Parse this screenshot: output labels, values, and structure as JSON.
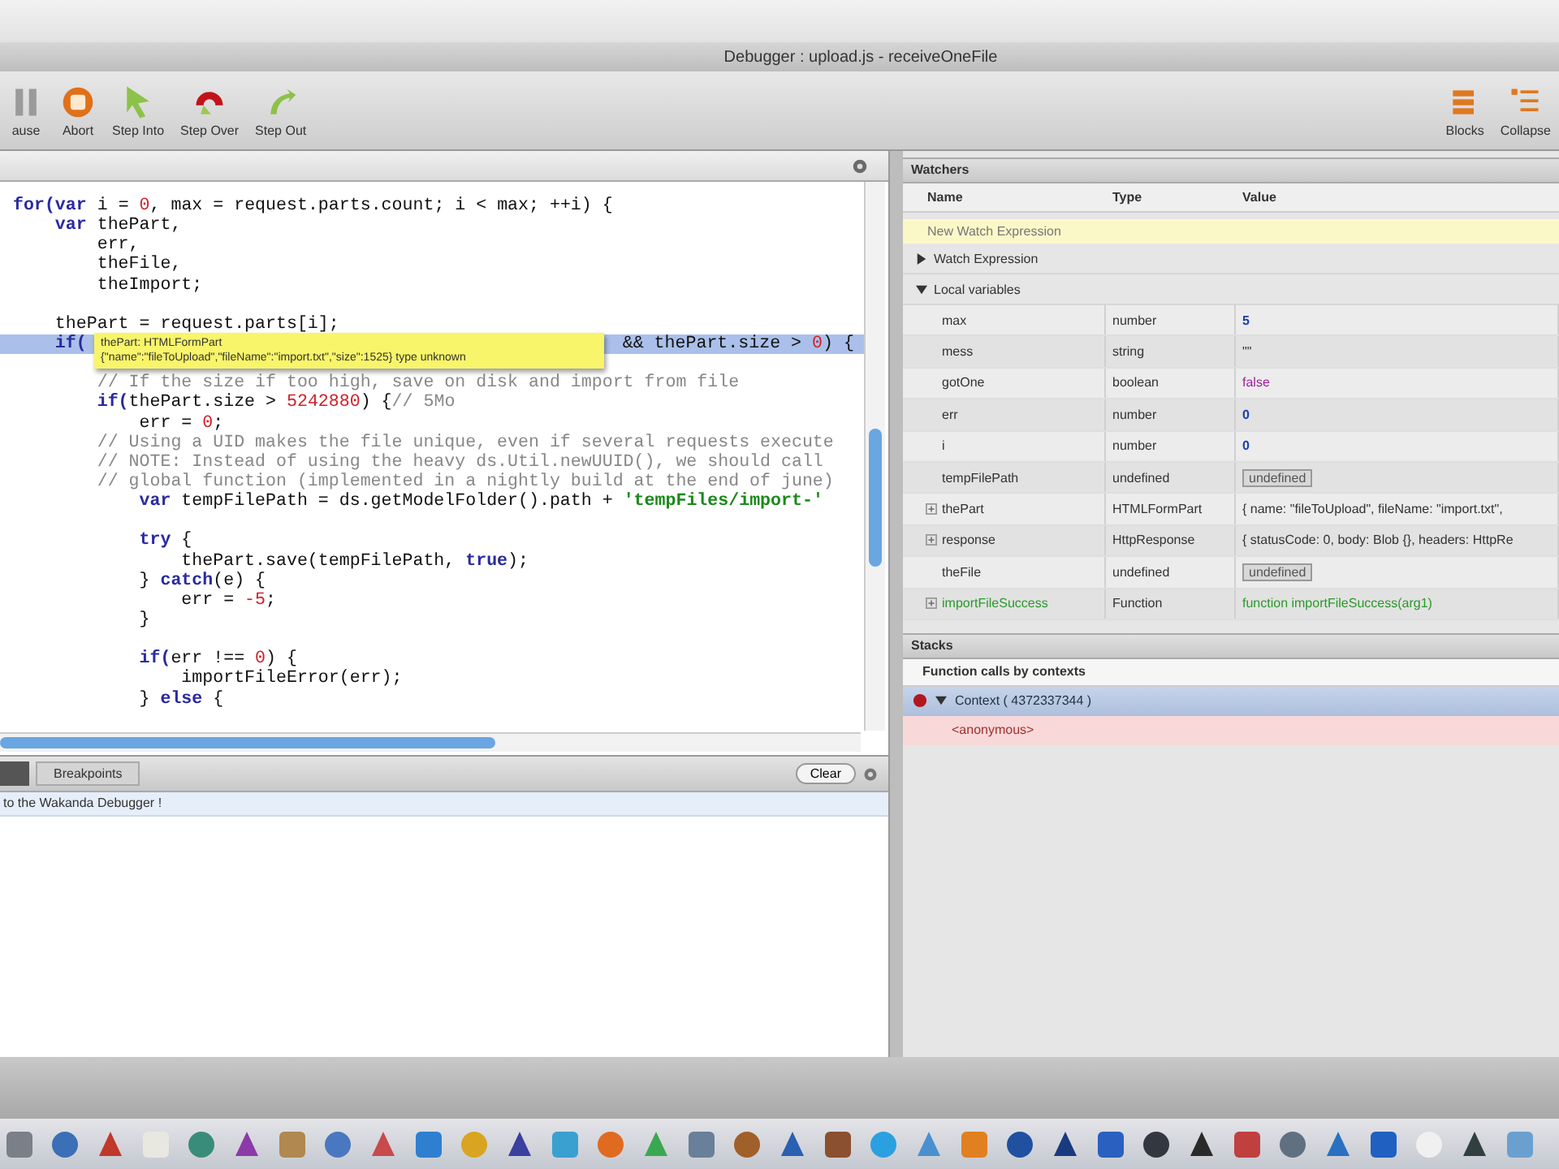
{
  "window": {
    "title": "Debugger : upload.js - receiveOneFile"
  },
  "toolbar": {
    "left": [
      {
        "label": "ause",
        "kind": "pause"
      },
      {
        "label": "Abort",
        "kind": "abort"
      },
      {
        "label": "Step Into",
        "kind": "step-into"
      },
      {
        "label": "Step Over",
        "kind": "step-over"
      },
      {
        "label": "Step Out",
        "kind": "step-out"
      }
    ],
    "right": [
      {
        "label": "Blocks",
        "kind": "blocks"
      },
      {
        "label": "Collapse",
        "kind": "collapse"
      }
    ]
  },
  "code": {
    "lines": [
      {
        "current": false,
        "segs": [
          {
            "text": "for(",
            "kind": "kw"
          },
          {
            "text": "var",
            "kind": "kw"
          },
          {
            "text": " i = ",
            "kind": "p"
          },
          {
            "text": "0",
            "kind": "num"
          },
          {
            "text": ", max = request.parts.count; i < max; ++i) {",
            "kind": "p"
          }
        ]
      },
      {
        "current": false,
        "segs": [
          {
            "text": "    var",
            "kind": "kw"
          },
          {
            "text": " thePart,",
            "kind": "p"
          }
        ]
      },
      {
        "current": false,
        "segs": [
          {
            "text": "        err,",
            "kind": "p"
          }
        ]
      },
      {
        "current": false,
        "segs": [
          {
            "text": "        theFile,",
            "kind": "p"
          }
        ]
      },
      {
        "current": false,
        "segs": [
          {
            "text": "        theImport;",
            "kind": "p"
          }
        ]
      },
      {
        "current": false
      },
      {
        "current": false,
        "segs": [
          {
            "text": "    thePart = request.parts[i];",
            "kind": "p"
          }
        ]
      },
      {
        "current": true,
        "segs": [
          {
            "text": "    if(",
            "kind": "kw"
          }
        ],
        "tail": [
          {
            "text": "&& thePart.size > ",
            "kind": "p"
          },
          {
            "text": "0",
            "kind": "num"
          },
          {
            "text": ") {",
            "kind": "p"
          }
        ]
      },
      {
        "current": false
      },
      {
        "current": false,
        "segs": [
          {
            "text": "        // If the size if too high, save on disk and import from file",
            "kind": "com"
          }
        ]
      },
      {
        "current": false,
        "segs": [
          {
            "text": "        if(",
            "kind": "kw"
          },
          {
            "text": "thePart.size > ",
            "kind": "p"
          },
          {
            "text": "5242880",
            "kind": "num"
          },
          {
            "text": ") {",
            "kind": "p"
          },
          {
            "text": "// 5Mo",
            "kind": "com"
          }
        ]
      },
      {
        "current": false,
        "segs": [
          {
            "text": "            err = ",
            "kind": "p"
          },
          {
            "text": "0",
            "kind": "num"
          },
          {
            "text": ";",
            "kind": "p"
          }
        ]
      },
      {
        "current": false,
        "segs": [
          {
            "text": "        // Using a UID makes the file unique, even if several requests execute",
            "kind": "com"
          }
        ]
      },
      {
        "current": false,
        "segs": [
          {
            "text": "        // NOTE: Instead of using the heavy ds.Util.newUUID(), we should call",
            "kind": "com"
          }
        ]
      },
      {
        "current": false,
        "segs": [
          {
            "text": "        // global function (implemented in a nightly build at the end of june)",
            "kind": "com"
          }
        ]
      },
      {
        "current": false,
        "segs": [
          {
            "text": "            var",
            "kind": "kw"
          },
          {
            "text": " tempFilePath = ds.getModelFolder().path + ",
            "kind": "p"
          },
          {
            "text": "'tempFiles/import-'",
            "kind": "str"
          }
        ]
      },
      {
        "current": false
      },
      {
        "current": false,
        "segs": [
          {
            "text": "            try",
            "kind": "kw"
          },
          {
            "text": " {",
            "kind": "p"
          }
        ]
      },
      {
        "current": false,
        "segs": [
          {
            "text": "                thePart.save(tempFilePath, ",
            "kind": "p"
          },
          {
            "text": "true",
            "kind": "kw"
          },
          {
            "text": ");",
            "kind": "p"
          }
        ]
      },
      {
        "current": false,
        "segs": [
          {
            "text": "            } ",
            "kind": "p"
          },
          {
            "text": "catch",
            "kind": "kw"
          },
          {
            "text": "(e) {",
            "kind": "p"
          }
        ]
      },
      {
        "current": false,
        "segs": [
          {
            "text": "                err = ",
            "kind": "p"
          },
          {
            "text": "-5",
            "kind": "num"
          },
          {
            "text": ";",
            "kind": "p"
          }
        ]
      },
      {
        "current": false,
        "segs": [
          {
            "text": "            }",
            "kind": "p"
          }
        ]
      },
      {
        "current": false
      },
      {
        "current": false,
        "segs": [
          {
            "text": "            if(",
            "kind": "kw"
          },
          {
            "text": "err !== ",
            "kind": "p"
          },
          {
            "text": "0",
            "kind": "num"
          },
          {
            "text": ") {",
            "kind": "p"
          }
        ]
      },
      {
        "current": false,
        "segs": [
          {
            "text": "                importFileError(err);",
            "kind": "p"
          }
        ]
      },
      {
        "current": false,
        "segs": [
          {
            "text": "            } ",
            "kind": "p"
          },
          {
            "text": "else",
            "kind": "kw"
          },
          {
            "text": " {",
            "kind": "p"
          }
        ]
      }
    ],
    "tooltip": {
      "title": "thePart: HTMLFormPart",
      "detail": "{\"name\":\"fileToUpload\",\"fileName\":\"import.txt\",\"size\":1525} type unknown"
    }
  },
  "console": {
    "tabs": [
      {
        "label": "Breakpoints",
        "selected": false
      }
    ],
    "clear_button": "Clear",
    "messages": [
      "to the Wakanda Debugger !"
    ]
  },
  "watchers": {
    "title": "Watchers",
    "columns": [
      "Name",
      "Type",
      "Value"
    ],
    "new_expression": "New Watch Expression",
    "groups": [
      {
        "label": "Watch Expression",
        "expanded": false
      },
      {
        "label": "Local variables",
        "expanded": true,
        "rows": [
          {
            "name": "max",
            "type": "number",
            "value": "5",
            "kind": "number",
            "expandable": false
          },
          {
            "name": "mess",
            "type": "string",
            "value": "\"\"",
            "kind": "string",
            "expandable": false
          },
          {
            "name": "gotOne",
            "type": "boolean",
            "value": "false",
            "kind": "boolean",
            "expandable": false
          },
          {
            "name": "err",
            "type": "number",
            "value": "0",
            "kind": "number",
            "expandable": false
          },
          {
            "name": "i",
            "type": "number",
            "value": "0",
            "kind": "number",
            "expandable": false
          },
          {
            "name": "tempFilePath",
            "type": "undefined",
            "value": "undefined",
            "kind": "undefined",
            "expandable": false
          },
          {
            "name": "thePart",
            "type": "HTMLFormPart",
            "value": "{ name: \"fileToUpload\", fileName: \"import.txt\",",
            "kind": "object",
            "expandable": true
          },
          {
            "name": "response",
            "type": "HttpResponse",
            "value": "{ statusCode: 0, body: Blob {}, headers: HttpRe",
            "kind": "object",
            "expandable": true
          },
          {
            "name": "theFile",
            "type": "undefined",
            "value": "undefined",
            "kind": "undefined",
            "expandable": false
          },
          {
            "name": "importFileSuccess",
            "type": "Function",
            "value": "function importFileSuccess(arg1)",
            "kind": "function",
            "expandable": true
          }
        ]
      }
    ]
  },
  "stacks": {
    "title": "Stacks",
    "heading": "Function calls by contexts",
    "contexts": [
      {
        "label": "Context ( 4372337344 )",
        "expanded": true,
        "frames": [
          {
            "label": "<anonymous>",
            "current": true
          }
        ]
      }
    ]
  }
}
